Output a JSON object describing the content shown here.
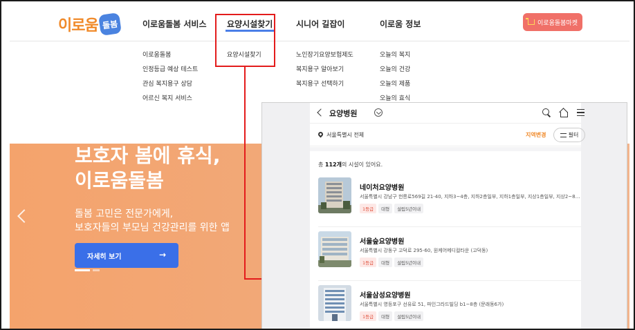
{
  "header": {
    "logo_text": "이로움",
    "logo_badge": "돌봄",
    "nav": [
      {
        "label": "이로움돌봄 서비스"
      },
      {
        "label": "요양시설찾기"
      },
      {
        "label": "시니어 길잡이"
      },
      {
        "label": "이로움 정보"
      }
    ],
    "mall_button": "이로움돌봄마켓"
  },
  "dropdown": {
    "col1": [
      "이로움돌봄",
      "인정등급 예상 테스트",
      "관심 복지용구 상담",
      "어르신 복지 서비스"
    ],
    "col2": [
      "요양시설찾기"
    ],
    "col3": [
      "노인장기요양보험제도",
      "복지용구 알아보기",
      "복지용구 선택하기"
    ],
    "col4": [
      "오늘의 복지",
      "오늘의 건강",
      "오늘의 제품",
      "오늘의 효식"
    ]
  },
  "hero": {
    "title_line1": "보호자 봄에 휴식,",
    "title_line2": "이로움돌봄",
    "desc_line1": "돌봄 고민은 전문가에게,",
    "desc_line2": "보호자들의 부모님 건강관리를 위한 앱",
    "button": "자세히 보기",
    "button_arrow": "→"
  },
  "app": {
    "title": "요양병원",
    "region": "서울특별시 전체",
    "region_change": "지역변경",
    "filter": "필터",
    "count_prefix": "총 ",
    "count_value": "112개",
    "count_suffix": "의 시설이 있어요.",
    "facilities": [
      {
        "name": "네이처요양병원",
        "address": "서울특별시 강남구 헌릉로569길 21-40, 지하3~4층, 지하2층일부, 지하1층일부, 지상1층일부, 지상2~8층 (세...",
        "grade": "1등급",
        "size": "대형",
        "year": "설립5년이내"
      },
      {
        "name": "서울숲요양병원",
        "address": "서울특별시 강동구 고덕로 295-60, 원케어메디컬타운 (고덕동)",
        "grade": "1등급",
        "size": "대형",
        "year": "설립5년이내"
      },
      {
        "name": "서울삼성요양병원",
        "address": "서울특별시 영등포구 선유로 51, 파인그라드빌딩 b1~8층 (문래동6가)",
        "grade": "1등급",
        "size": "대형",
        "year": "설립5년이내"
      }
    ]
  },
  "colors": {
    "accent_red": "#e31b1b",
    "brand_orange": "#f08a2a",
    "hero_orange": "#f4a36c",
    "primary_blue": "#3a6fe8",
    "mall_pink": "#f07068"
  }
}
